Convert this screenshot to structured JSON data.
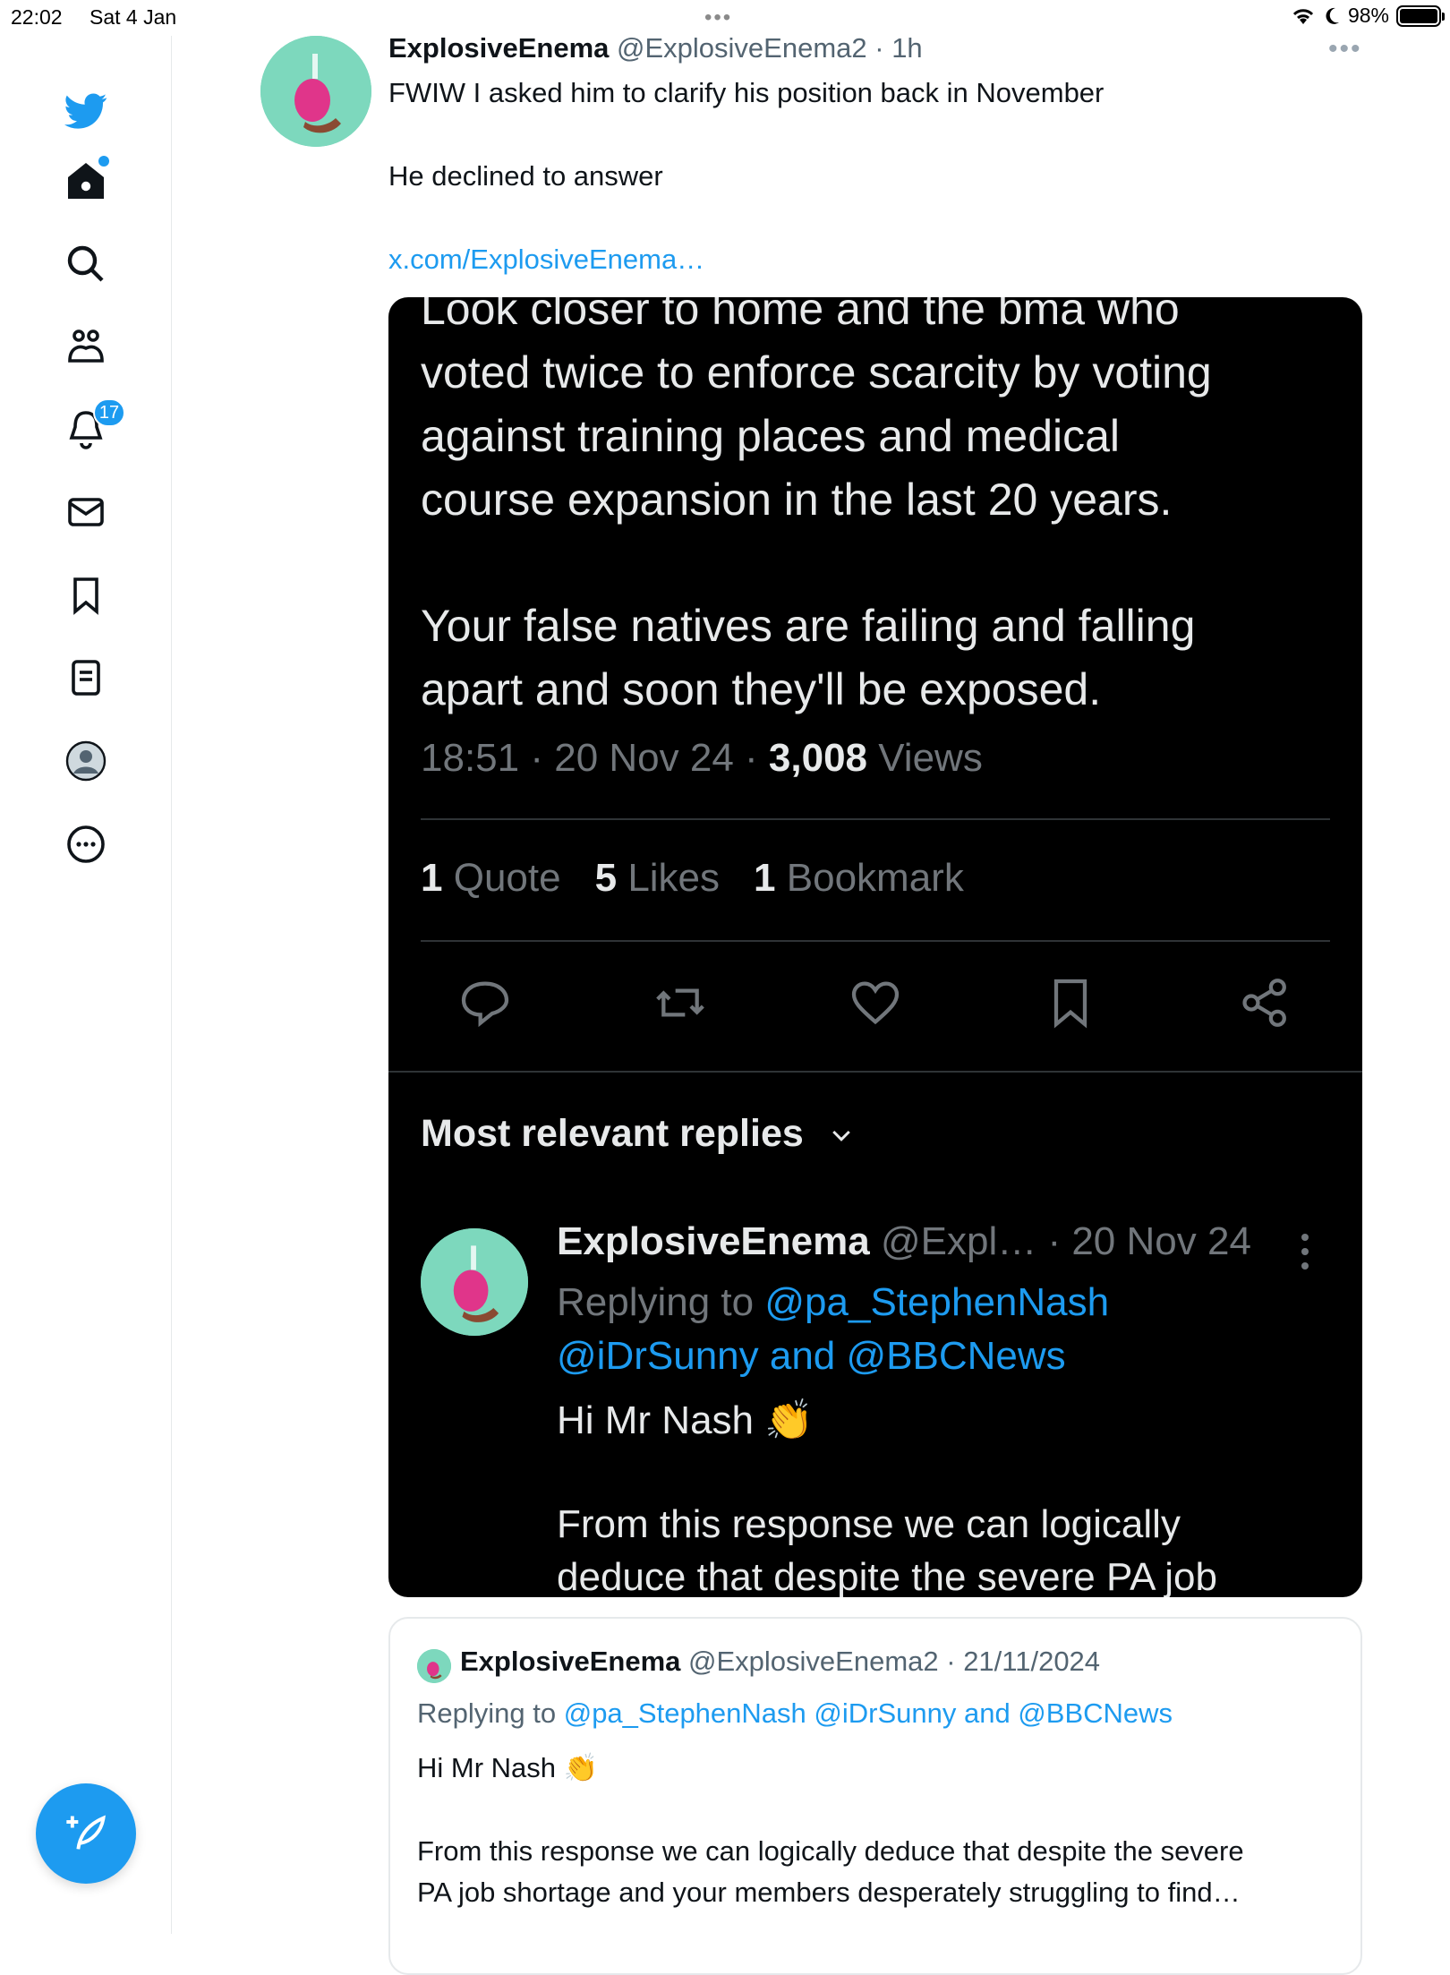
{
  "status_bar": {
    "time": "22:02",
    "date": "Sat 4 Jan",
    "dots": "•••",
    "battery": "98%"
  },
  "sidebar": {
    "notifications_count": "17",
    "items": [
      "twitter-logo",
      "home",
      "search",
      "communities",
      "notifications",
      "messages",
      "bookmarks",
      "lists",
      "profile",
      "more"
    ]
  },
  "tweet": {
    "name": "ExplosiveEnema",
    "handle": "@ExplosiveEnema2",
    "time": " · 1h",
    "more": "•••",
    "lines": [
      "FWIW I asked him to clarify his position back in November",
      "He declined to answer"
    ],
    "link": "x.com/ExplosiveEnema…"
  },
  "embedded": {
    "text_lines": [
      "Look closer to home and the bma who",
      "voted twice to enforce scarcity by voting",
      "against training places and medical",
      "course expansion in the last 20 years.",
      "Your false natives are failing and falling",
      "apart and soon they'll be exposed."
    ],
    "meta": {
      "time": "18:51",
      "date": "20 Nov 24",
      "views_count": "3,008",
      "views_label": "Views"
    },
    "stats": [
      {
        "count": "1",
        "label": "Quote"
      },
      {
        "count": "5",
        "label": "Likes"
      },
      {
        "count": "1",
        "label": "Bookmark"
      }
    ],
    "most_relevant": "Most relevant replies",
    "reply": {
      "name": "ExplosiveEnema",
      "handle": "@Expl…",
      "date": " · 20 Nov 24",
      "replying_to": "Replying to",
      "mention1": "@pa_StephenNash",
      "mention2": "@iDrSunny and @BBCNews",
      "greeting": "Hi Mr Nash 👏",
      "body1": "From this response we can logically",
      "body2": "deduce that despite the severe PA job"
    }
  },
  "quote": {
    "name": "ExplosiveEnema",
    "handle": "@ExplosiveEnema2",
    "date": " · 21/11/2024",
    "replying_to": "Replying to",
    "mentions": "@pa_StephenNash @iDrSunny and @BBCNews",
    "greeting": "Hi Mr Nash 👏",
    "body1": "From this response we can logically deduce that despite the severe",
    "body2": "PA job shortage and your members desperately struggling to find…"
  },
  "colors": {
    "accent": "#1d9bf0",
    "dark_bg": "#000000",
    "muted": "#536471"
  }
}
